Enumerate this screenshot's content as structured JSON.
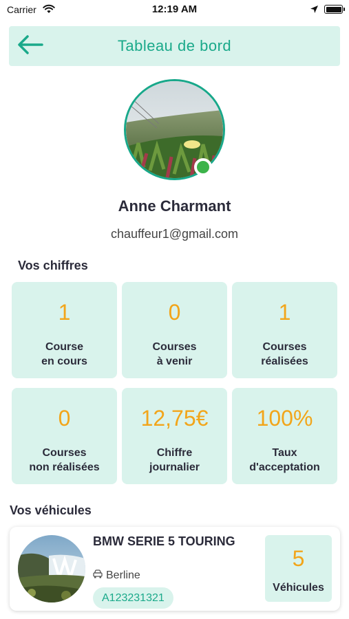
{
  "status_bar": {
    "carrier": "Carrier",
    "time": "12:19 AM",
    "icons": [
      "wifi-icon",
      "location-arrow-icon",
      "battery-icon"
    ]
  },
  "header": {
    "title": "Tableau de bord",
    "back_icon": "arrow-left-icon"
  },
  "profile": {
    "name": "Anne Charmant",
    "email": "chauffeur1@gmail.com",
    "online": true
  },
  "stats_section": {
    "title": "Vos chiffres",
    "cards": [
      {
        "value": "1",
        "label": "Course\nen cours"
      },
      {
        "value": "0",
        "label": "Courses\nà venir"
      },
      {
        "value": "1",
        "label": "Courses\nréalisées"
      },
      {
        "value": "0",
        "label": "Courses\nnon réalisées"
      },
      {
        "value": "12,75€",
        "label": "Chiffre\njournalier"
      },
      {
        "value": "100%",
        "label": "Taux\nd'acceptation"
      }
    ]
  },
  "vehicles_section": {
    "title": "Vos véhicules",
    "vehicle": {
      "name": "BMW SERIE 5 TOURING",
      "type": "Berline",
      "type_icon": "car-icon",
      "plate": "A123231321"
    },
    "count": {
      "value": "5",
      "label": "Véhicules"
    }
  },
  "colors": {
    "accent": "#1aa98a",
    "card_bg": "#d9f3ec",
    "value": "#f2a51a",
    "online": "#3cb34a"
  }
}
